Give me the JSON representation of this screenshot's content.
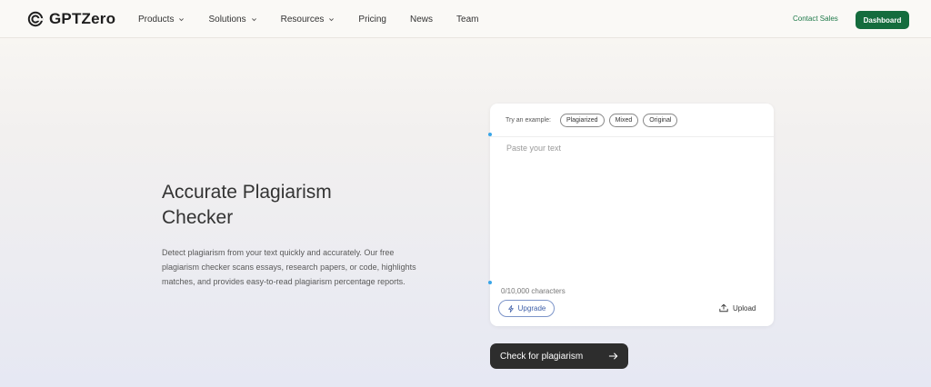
{
  "nav": {
    "logo_text": "GPTZero",
    "menu": [
      {
        "label": "Products",
        "has_dropdown": true
      },
      {
        "label": "Solutions",
        "has_dropdown": true
      },
      {
        "label": "Resources",
        "has_dropdown": true
      },
      {
        "label": "Pricing",
        "has_dropdown": false
      },
      {
        "label": "News",
        "has_dropdown": false
      },
      {
        "label": "Team",
        "has_dropdown": false
      }
    ],
    "contact_label": "Contact Sales",
    "dashboard_label": "Dashboard"
  },
  "hero": {
    "title": "Accurate Plagiarism Checker",
    "description": "Detect plagiarism from your text quickly and accurately. Our free plagiarism checker scans essays, research papers, or code, highlights matches, and provides easy-to-read plagiarism percentage reports."
  },
  "checker": {
    "try_label": "Try an example:",
    "examples": [
      "Plagiarized",
      "Mixed",
      "Original"
    ],
    "placeholder": "Paste your text",
    "char_count": "0/10,000 characters",
    "upgrade_label": "Upgrade",
    "upload_label": "Upload",
    "submit_label": "Check for plagiarism"
  },
  "colors": {
    "brand_green": "#146c3d",
    "contact_green": "#1f7a4a",
    "upgrade_blue": "#3f5fa8",
    "button_dark": "#2d2d2d"
  },
  "icons": {
    "logo": "gptzero-logo-icon",
    "dropdown": "chevron-down-icon",
    "upgrade": "lightning-icon",
    "upload": "upload-icon",
    "submit": "arrow-right-icon"
  }
}
